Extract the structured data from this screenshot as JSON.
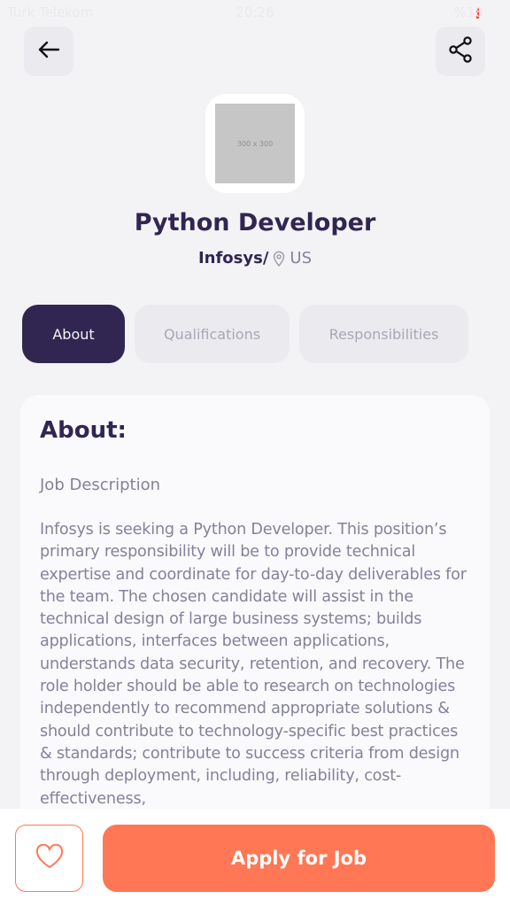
{
  "status_bar": {
    "carrier": "Turk Telekom",
    "time": "20:26",
    "battery": "%18"
  },
  "header": {
    "back_icon": "arrow-left-icon",
    "share_icon": "share-icon"
  },
  "job": {
    "logo_placeholder": "300 x 300",
    "title": "Python Developer",
    "company": "Infosys/",
    "location": "US",
    "location_icon": "location-pin-icon"
  },
  "tabs": [
    {
      "label": "About",
      "active": true
    },
    {
      "label": "Qualifications",
      "active": false
    },
    {
      "label": "Responsibilities",
      "active": false
    }
  ],
  "about": {
    "heading": "About:",
    "subheading": "Job Description",
    "body": "Infosys is seeking a Python Developer. This position’s primary responsibility will be to provide technical expertise and coordinate for day-to-day deliverables for the team. The chosen candidate will assist in the technical design of large business systems; builds applications, interfaces between applications, understands data security, retention, and recovery. The role holder should be able to research on technologies independently to recommend appropriate solutions & should contribute to technology-specific best practices & standards; contribute to success criteria from design through deployment, including, reliability, cost-effectiveness,"
  },
  "footer": {
    "favorite_icon": "heart-outline-icon",
    "apply_label": "Apply for Job"
  },
  "colors": {
    "primary": "#312651",
    "accent": "#ff7754",
    "tab_inactive": "#ebebef",
    "text_gray": "#83829a",
    "background": "#f3f3f6"
  }
}
